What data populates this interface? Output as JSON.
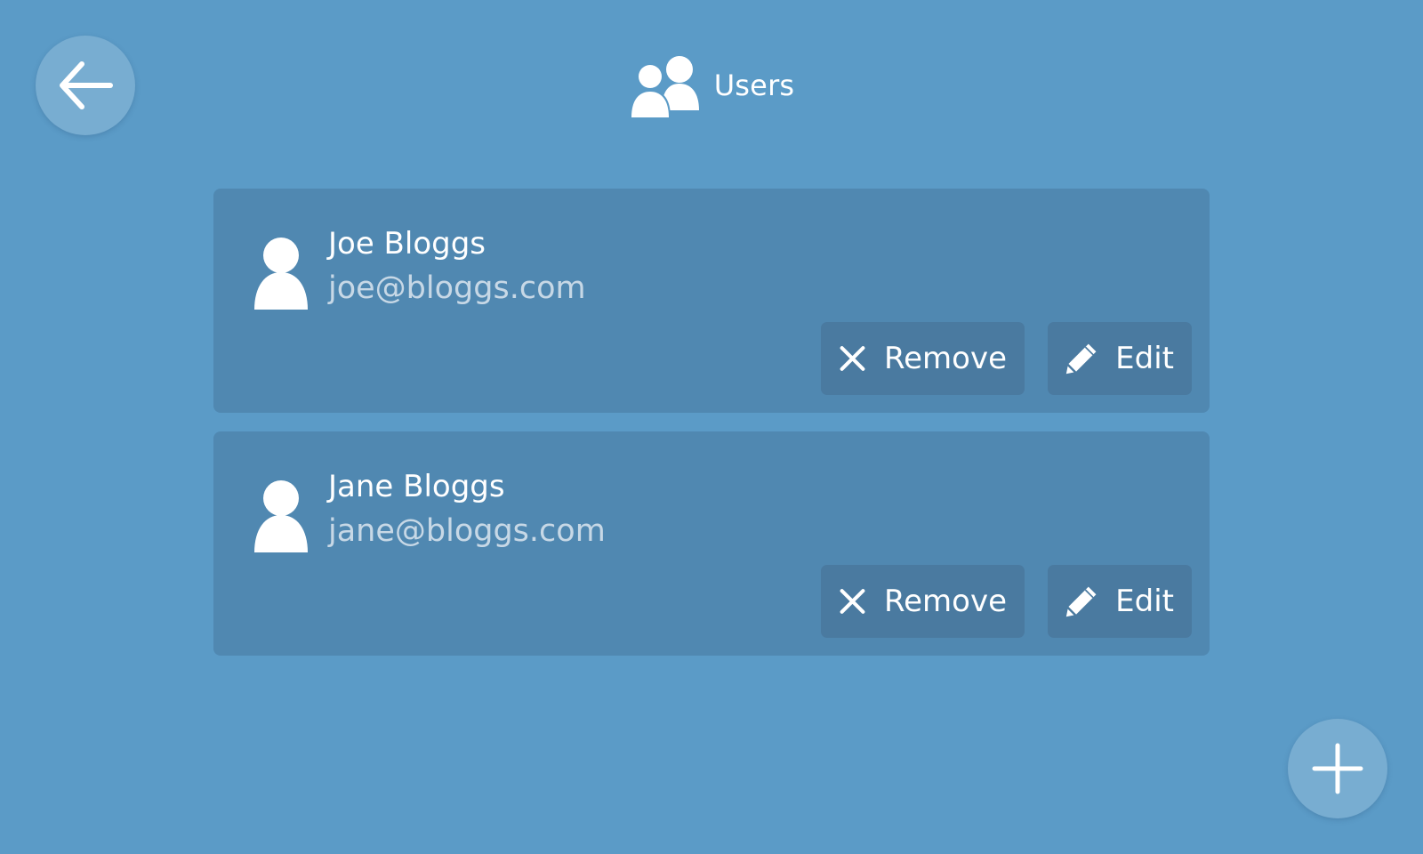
{
  "header": {
    "title": "Users",
    "icon": "users-icon"
  },
  "navigation": {
    "back_icon": "arrow-left-icon",
    "add_icon": "plus-icon"
  },
  "users": [
    {
      "name": "Joe Bloggs",
      "email": "joe@bloggs.com",
      "remove_label": "Remove",
      "edit_label": "Edit"
    },
    {
      "name": "Jane Bloggs",
      "email": "jane@bloggs.com",
      "remove_label": "Remove",
      "edit_label": "Edit"
    }
  ],
  "colors": {
    "background": "#5b9bc7",
    "card": "#5088b1",
    "button": "#4a7aa0",
    "email_text": "#c7d8e6"
  }
}
